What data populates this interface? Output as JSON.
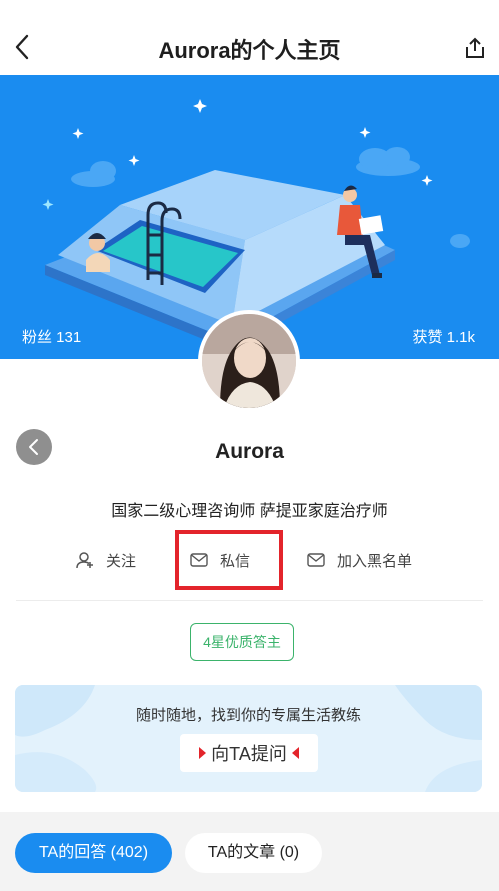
{
  "header": {
    "title": "Aurora的个人主页",
    "back_icon": "back-arrow-icon",
    "share_icon": "share-icon"
  },
  "banner": {
    "background_color": "#1a8cf0",
    "fans_text": "粉丝 131",
    "likes_text": "获赞 1.1k"
  },
  "profile": {
    "name": "Aurora",
    "bio": "国家二级心理咨询师 萨提亚家庭治疗师"
  },
  "actions": {
    "follow_label": "关注",
    "message_label": "私信",
    "block_label": "加入黑名单",
    "highlight_color": "#e3242b"
  },
  "badge": {
    "label": "4星优质答主",
    "color": "#3bb36b"
  },
  "promo": {
    "text": "随时随地，找到你的专属生活教练",
    "ask_button": "向TA提问"
  },
  "tabs": {
    "answers": "TA的回答 (402)",
    "articles": "TA的文章 (0)",
    "active_color": "#1a8cf0"
  }
}
